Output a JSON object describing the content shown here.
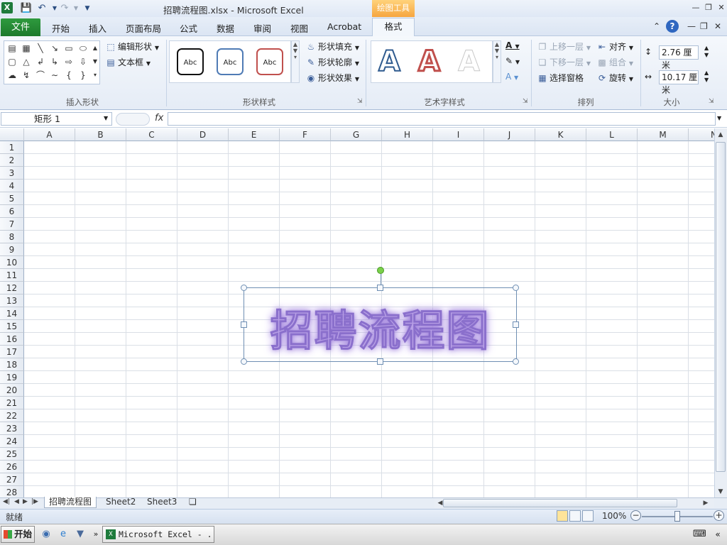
{
  "window": {
    "title": "招聘流程图.xlsx  -  Microsoft Excel",
    "context_tool": "绘图工具"
  },
  "tabs": [
    "开始",
    "插入",
    "页面布局",
    "公式",
    "数据",
    "审阅",
    "视图",
    "Acrobat"
  ],
  "file_tab": "文件",
  "active_tab": "格式",
  "groups": {
    "insert_shapes": {
      "label": "插入形状",
      "edit_shape": "编辑形状",
      "text_box": "文本框"
    },
    "shape_styles": {
      "label": "形状样式",
      "sample": "Abc",
      "fill": "形状填充",
      "outline": "形状轮廓",
      "effects": "形状效果"
    },
    "wordart_styles": {
      "label": "艺术字样式",
      "letter": "A"
    },
    "arrange": {
      "label": "排列",
      "bring_forward": "上移一层",
      "send_backward": "下移一层",
      "selection_pane": "选择窗格",
      "align": "对齐",
      "group": "组合",
      "rotate": "旋转"
    },
    "size": {
      "label": "大小",
      "height": "2.76 厘米",
      "width": "10.17 厘米"
    }
  },
  "formula_bar": {
    "name_box": "矩形 1",
    "fx": "fx",
    "value": ""
  },
  "columns": [
    "A",
    "B",
    "C",
    "D",
    "E",
    "F",
    "G",
    "H",
    "I",
    "J",
    "K",
    "L",
    "M",
    "N"
  ],
  "rows": [
    "1",
    "2",
    "3",
    "4",
    "5",
    "6",
    "7",
    "8",
    "9",
    "10",
    "11",
    "12",
    "13",
    "14",
    "15",
    "16",
    "17",
    "18",
    "19",
    "20",
    "21",
    "22",
    "23",
    "24",
    "25",
    "26",
    "27",
    "28"
  ],
  "shape": {
    "text": "招聘流程图",
    "color": "#b8a0e6"
  },
  "sheets": [
    "招聘流程图",
    "Sheet2",
    "Sheet3"
  ],
  "status": {
    "text": "就绪",
    "zoom": "100%"
  },
  "taskbar": {
    "start": "开始",
    "task": "Microsoft Excel - ..."
  }
}
